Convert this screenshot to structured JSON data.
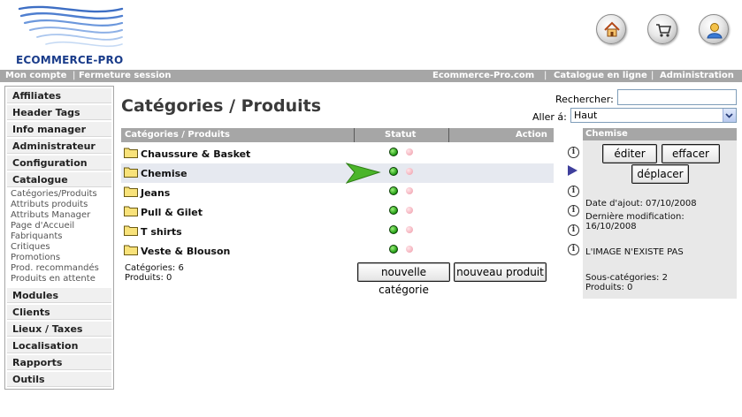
{
  "header": {
    "brand": "ECOMMERCE-PRO",
    "icons": [
      {
        "name": "home-icon"
      },
      {
        "name": "cart-icon"
      },
      {
        "name": "user-icon"
      }
    ]
  },
  "topbar": {
    "left": [
      "Mon compte",
      "Fermeture session"
    ],
    "right": [
      "Ecommerce-Pro.com",
      "Catalogue en ligne",
      "Administration"
    ],
    "separator": "|"
  },
  "sidebar": {
    "sections_top": [
      "Affiliates",
      "Header Tags",
      "Info manager",
      "Administrateur",
      "Configuration",
      "Catalogue"
    ],
    "catalogue_items": [
      "Catégories/Produits",
      "Attributs produits",
      "Attributs Manager",
      "Page d'Accueil",
      "Fabriquants",
      "Critiques",
      "Promotions",
      "Prod. recommandés",
      "Produits en attente"
    ],
    "sections_bottom": [
      "Modules",
      "Clients",
      "Lieux / Taxes",
      "Localisation",
      "Rapports",
      "Outils"
    ]
  },
  "main": {
    "title": "Catégories / Produits",
    "search_label": "Rechercher:",
    "search_value": "",
    "goto_label": "Aller á:",
    "goto_value": "Haut",
    "table_headers": {
      "name": "Catégories / Produits",
      "status": "Statut",
      "action": "Action"
    },
    "rows": [
      {
        "name": "Chaussure & Basket",
        "selected": false
      },
      {
        "name": "Chemise",
        "selected": true
      },
      {
        "name": "Jeans",
        "selected": false
      },
      {
        "name": "Pull & Gilet",
        "selected": false
      },
      {
        "name": "T shirts",
        "selected": false
      },
      {
        "name": "Veste & Blouson",
        "selected": false
      }
    ],
    "counts": {
      "categories": "Catégories: 6",
      "products": "Produits: 0"
    },
    "buttons": {
      "new_category": "nouvelle catégorie",
      "new_product": "nouveau produit"
    }
  },
  "panel": {
    "title": "Chemise",
    "buttons": {
      "edit": "éditer",
      "delete": "effacer",
      "move": "déplacer"
    },
    "date_added": "Date d'ajout: 07/10/2008",
    "last_modified_label": "Dernière modification:",
    "last_modified_value": "16/10/2008",
    "image_note": "L'IMAGE N'EXISTE PAS",
    "subcategories": "Sous-catégories: 2",
    "products": "Produits: 0"
  },
  "colors": {
    "bar_gray": "#a6a6a6",
    "brand_blue": "#1a3c8a",
    "status_on": "#1f9a12",
    "status_off": "#f2a8b4",
    "selection_arrow": "#3f3f9c"
  }
}
